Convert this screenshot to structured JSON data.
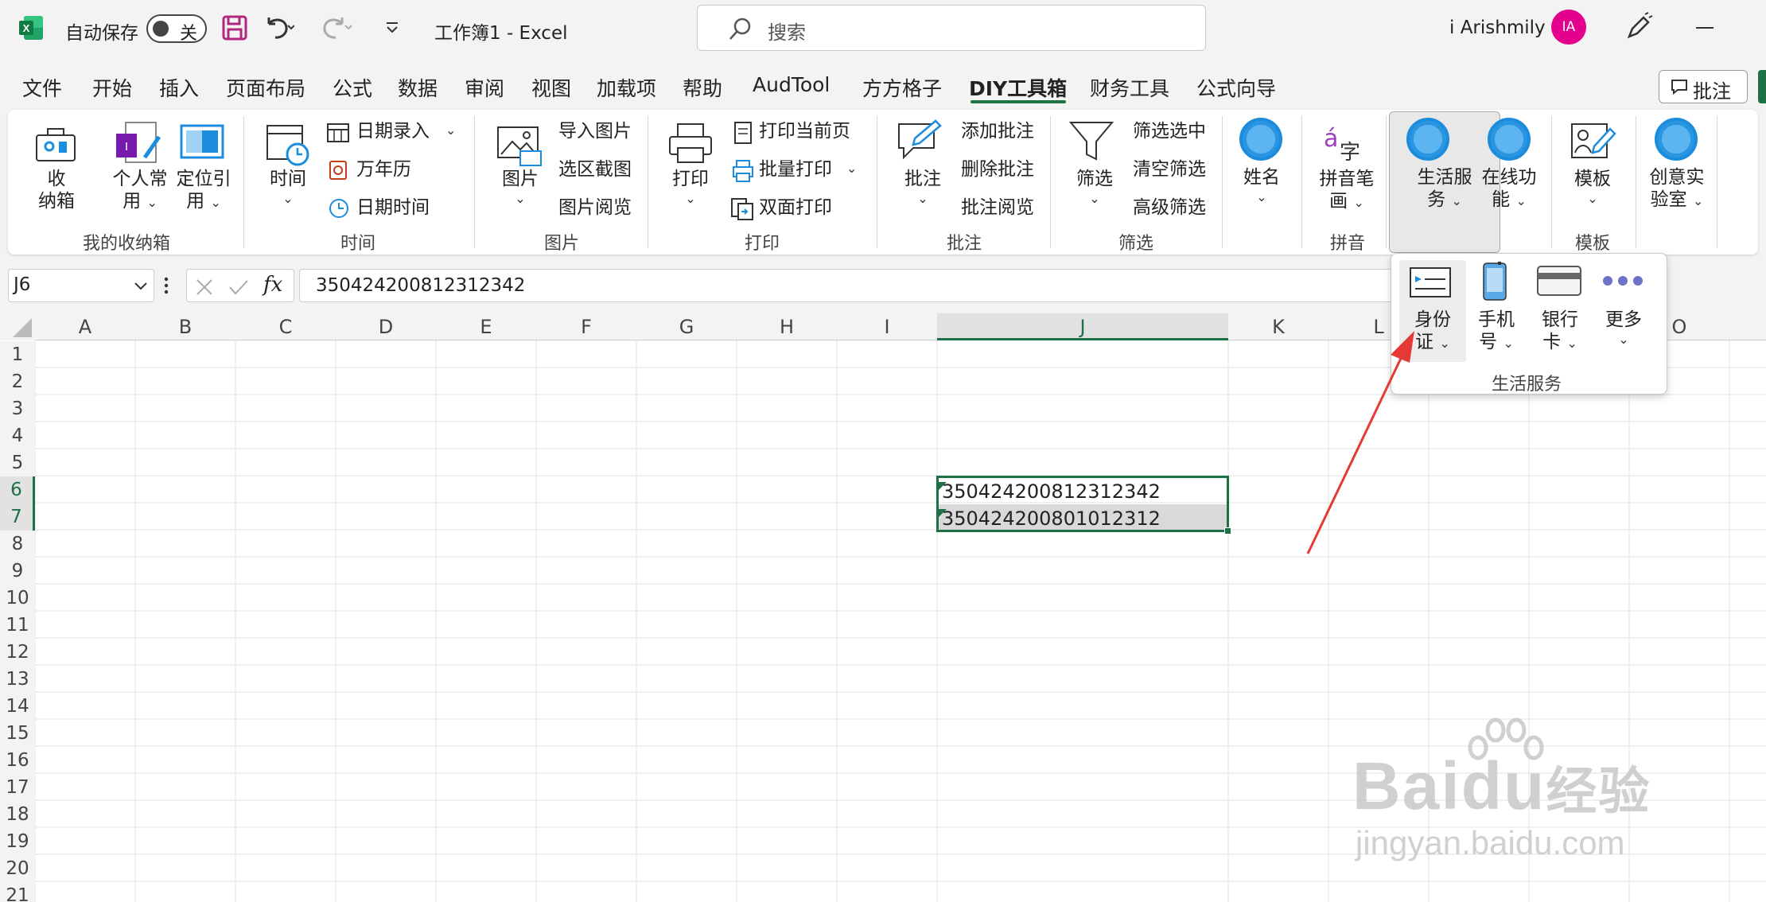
{
  "titlebar": {
    "autosave_label": "自动保存",
    "autosave_state": "关",
    "document_title": "工作簿1  -  Excel",
    "search_placeholder": "搜索",
    "user_name": "i Arishmily",
    "avatar_initials": "IA"
  },
  "tabs": [
    "文件",
    "开始",
    "插入",
    "页面布局",
    "公式",
    "数据",
    "审阅",
    "视图",
    "加载项",
    "帮助",
    "AudTool",
    "方方格子",
    "DIY工具箱",
    "财务工具",
    "公式向导"
  ],
  "active_tab": "DIY工具箱",
  "comment_button": "批注",
  "ribbon": {
    "group1": {
      "label": "我的收纳箱",
      "b1": [
        "收",
        "纳箱"
      ],
      "b2": [
        "个人常",
        "用"
      ],
      "b3": [
        "定位引",
        "用"
      ]
    },
    "group2": {
      "label": "时间",
      "big": "时间",
      "items": [
        "日期录入",
        "万年历",
        "日期时间"
      ]
    },
    "group3": {
      "label": "图片",
      "big": "图片",
      "items": [
        "导入图片",
        "选区截图",
        "图片阅览"
      ]
    },
    "group4": {
      "label": "打印",
      "big": "打印",
      "items": [
        "打印当前页",
        "批量打印",
        "双面打印"
      ]
    },
    "group5": {
      "label": "批注",
      "big": "批注",
      "items": [
        "添加批注",
        "删除批注",
        "批注阅览"
      ]
    },
    "group6": {
      "label": "筛选",
      "big": "筛选",
      "items": [
        "筛选选中",
        "清空筛选",
        "高级筛选"
      ]
    },
    "name_button": "姓名",
    "group7": {
      "label": "拼音",
      "big": [
        "拼音笔",
        "画"
      ]
    },
    "life_service": [
      "生活服",
      "务"
    ],
    "online": [
      "在线功",
      "能"
    ],
    "group8": {
      "label": "模板",
      "big": "模板"
    },
    "creative": [
      "创意实",
      "验室"
    ]
  },
  "dropdown": {
    "items": [
      {
        "l1": "身份",
        "l2": "证"
      },
      {
        "l1": "手机",
        "l2": "号"
      },
      {
        "l1": "银行",
        "l2": "卡"
      },
      {
        "l1": "更多",
        "l2": ""
      }
    ],
    "group_label": "生活服务"
  },
  "formula_bar": {
    "name_box": "J6",
    "fx": "fx",
    "formula": "350424200812312342"
  },
  "columns": [
    "A",
    "B",
    "C",
    "D",
    "E",
    "F",
    "G",
    "H",
    "I",
    "J",
    "K",
    "L",
    "O"
  ],
  "rows": [
    "1",
    "2",
    "3",
    "4",
    "5",
    "6",
    "7",
    "8",
    "9",
    "10",
    "11",
    "12",
    "13",
    "14",
    "15",
    "16",
    "17",
    "18",
    "19",
    "20",
    "21"
  ],
  "cells": {
    "J6": "350424200812312342",
    "J7": "350424200801012312"
  },
  "watermark": {
    "brand": "Baidu",
    "brand_cn": "经验",
    "url": "jingyan.baidu.com"
  },
  "colors": {
    "accent": "#1e7145",
    "avatar": "#e3008c",
    "arrow": "#e53935"
  }
}
